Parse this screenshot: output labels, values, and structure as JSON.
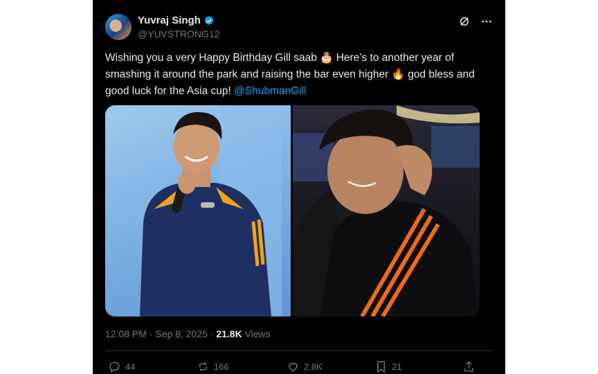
{
  "user": {
    "name": "Yuvraj Singh",
    "handle": "@YUVSTRONG12"
  },
  "tweet": {
    "text_part1": "Wishing you a very Happy Birthday Gill saab 🎂 Here’s to another year of smashing it around the park and raising the bar even higher 🔥 god bless and good luck for the Asia cup! ",
    "mention": "@ShubmanGill"
  },
  "meta": {
    "time": "12:08 PM · Sep 8, 2025 · ",
    "views_count": "21.8K",
    "views_label": " Views"
  },
  "actions": {
    "replies": "44",
    "reposts": "166",
    "likes": "2.8K",
    "bookmarks": "21"
  },
  "colors": {
    "accent": "#1d9bf0",
    "background": "#000000",
    "muted": "#71767b"
  },
  "icons": [
    "verified-badge-icon",
    "grok-icon",
    "more-icon",
    "reply-icon",
    "repost-icon",
    "like-icon",
    "bookmark-icon",
    "share-icon"
  ]
}
